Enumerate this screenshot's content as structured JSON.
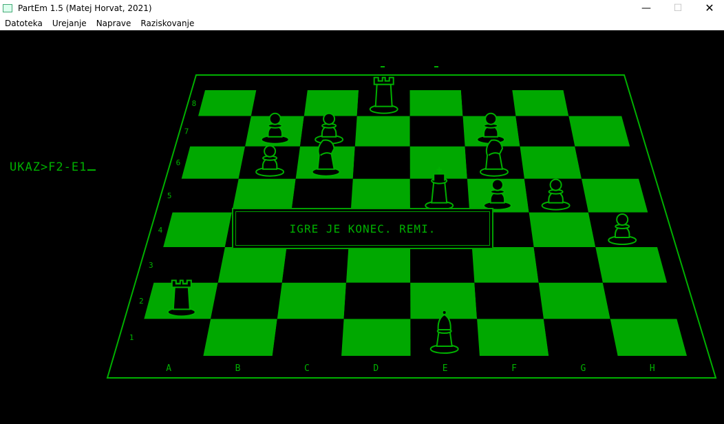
{
  "window": {
    "title": "PartEm 1.5 (Matej Horvat, 2021)",
    "minimize_glyph": "—",
    "maximize_glyph": "☐",
    "close_glyph": "✕"
  },
  "menu": {
    "items": [
      {
        "label": "Datoteka"
      },
      {
        "label": "Urejanje"
      },
      {
        "label": "Naprave"
      },
      {
        "label": "Raziskovanje"
      }
    ]
  },
  "terminal": {
    "prompt": "UKAZ>F2-E1"
  },
  "dialog": {
    "message": "IGRE JE KONEC. REMI."
  },
  "board": {
    "files": [
      "A",
      "B",
      "C",
      "D",
      "E",
      "F",
      "G",
      "H"
    ],
    "ranks": [
      "1",
      "2",
      "3",
      "4",
      "5",
      "6",
      "7",
      "8"
    ],
    "dark_color": "#000000",
    "light_color": "#00a800",
    "line_color": "#00b000",
    "pieces": [
      {
        "square": "D8",
        "type": "rook"
      },
      {
        "square": "B7",
        "type": "pawn"
      },
      {
        "square": "C7",
        "type": "pawn"
      },
      {
        "square": "F7",
        "type": "pawn"
      },
      {
        "square": "C6",
        "type": "knight"
      },
      {
        "square": "F6",
        "type": "knight"
      },
      {
        "square": "B6",
        "type": "pawn"
      },
      {
        "square": "E5",
        "type": "king"
      },
      {
        "square": "F5",
        "type": "pawn"
      },
      {
        "square": "G5",
        "type": "pawn"
      },
      {
        "square": "H4",
        "type": "pawn"
      },
      {
        "square": "A2",
        "type": "rook"
      },
      {
        "square": "E1",
        "type": "bishop"
      }
    ]
  }
}
